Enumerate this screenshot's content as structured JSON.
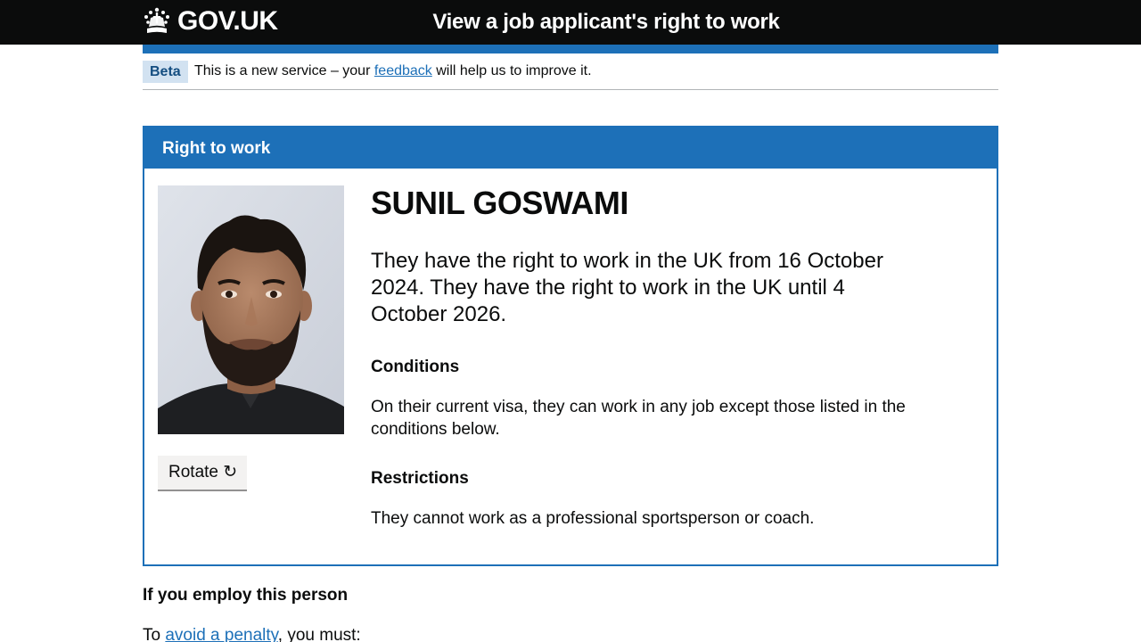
{
  "header": {
    "logo_text": "GOV.UK",
    "service_name": "View a job applicant's right to work"
  },
  "phase_banner": {
    "tag": "Beta",
    "text_before": "This is a new service – your ",
    "link_text": "feedback",
    "text_after": " will help us to improve it."
  },
  "card": {
    "title": "Right to work",
    "photo_icon": "applicant-photo",
    "rotate_label": "Rotate ↻",
    "name": "SUNIL GOSWAMI",
    "statement": "They have the right to work in the UK from 16 October 2024. They have the right to work in the UK until 4 October 2026.",
    "conditions_heading": "Conditions",
    "conditions_text": "On their current visa, they can work in any job except those listed in the conditions below.",
    "restrictions_heading": "Restrictions",
    "restrictions_text": "They cannot work as a professional sportsperson or coach."
  },
  "employ": {
    "heading": "If you employ this person",
    "text_before": "To ",
    "link_text": "avoid a penalty",
    "text_after": ", you must:"
  },
  "colors": {
    "header_bg": "#0b0c0c",
    "brand_blue": "#1d70b8",
    "beta_tag_bg": "#d2e2f1",
    "button_bg": "#f3f2f1"
  }
}
